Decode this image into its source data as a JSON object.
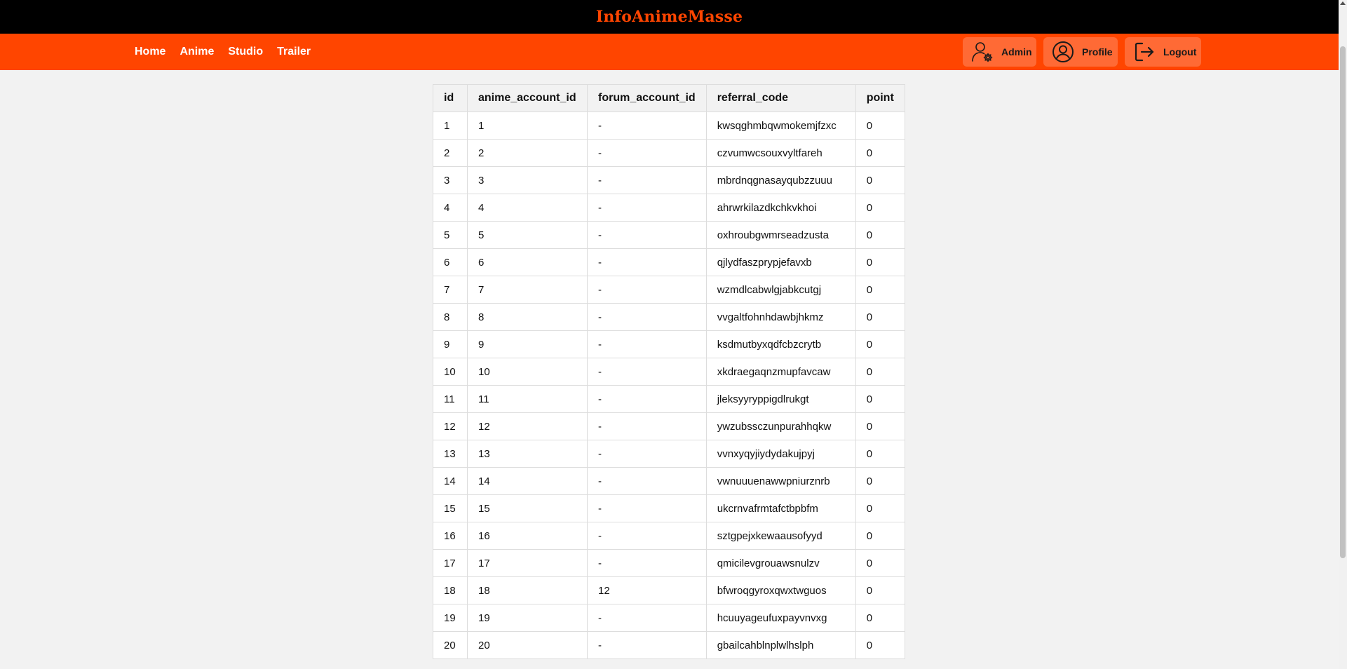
{
  "site": {
    "title": "InfoAnimeMasse"
  },
  "nav": {
    "links": [
      "Home",
      "Anime",
      "Studio",
      "Trailer"
    ],
    "actions": [
      {
        "label": "Admin",
        "icon": "admin-gear-icon"
      },
      {
        "label": "Profile",
        "icon": "user-circle-icon"
      },
      {
        "label": "Logout",
        "icon": "logout-icon"
      }
    ]
  },
  "colors": {
    "title_bar": "#000000",
    "nav_bar": "#ff4500",
    "accent": "#ff4500",
    "button_bg": "#ff6a35"
  },
  "table": {
    "columns": [
      "id",
      "anime_account_id",
      "forum_account_id",
      "referral_code",
      "point"
    ],
    "rows": [
      [
        "1",
        "1",
        "-",
        "kwsqghmbqwmokemjfzxc",
        "0"
      ],
      [
        "2",
        "2",
        "-",
        "czvumwcsouxvyltfareh",
        "0"
      ],
      [
        "3",
        "3",
        "-",
        "mbrdnqgnasayqubzzuuu",
        "0"
      ],
      [
        "4",
        "4",
        "-",
        "ahrwrkilazdkchkvkhoi",
        "0"
      ],
      [
        "5",
        "5",
        "-",
        "oxhroubgwmrseadzusta",
        "0"
      ],
      [
        "6",
        "6",
        "-",
        "qjlydfaszprypjefavxb",
        "0"
      ],
      [
        "7",
        "7",
        "-",
        "wzmdlcabwlgjabkcutgj",
        "0"
      ],
      [
        "8",
        "8",
        "-",
        "vvgaltfohnhdawbjhkmz",
        "0"
      ],
      [
        "9",
        "9",
        "-",
        "ksdmutbyxqdfcbzcrytb",
        "0"
      ],
      [
        "10",
        "10",
        "-",
        "xkdraegaqnzmupfavcaw",
        "0"
      ],
      [
        "11",
        "11",
        "-",
        "jleksyyryppigdlrukgt",
        "0"
      ],
      [
        "12",
        "12",
        "-",
        "ywzubssczunpurahhqkw",
        "0"
      ],
      [
        "13",
        "13",
        "-",
        "vvnxyqyjiydydakujpyj",
        "0"
      ],
      [
        "14",
        "14",
        "-",
        "vwnuuuenawwpniurznrb",
        "0"
      ],
      [
        "15",
        "15",
        "-",
        "ukcrnvafrmtafctbpbfm",
        "0"
      ],
      [
        "16",
        "16",
        "-",
        "sztgpejxkewaausofyyd",
        "0"
      ],
      [
        "17",
        "17",
        "-",
        "qmicilevgrouawsnulzv",
        "0"
      ],
      [
        "18",
        "18",
        "12",
        "bfwroqgyroxqwxtwguos",
        "0"
      ],
      [
        "19",
        "19",
        "-",
        "hcuuyageufuxpayvnvxg",
        "0"
      ],
      [
        "20",
        "20",
        "-",
        "gbailcahblnplwlhslph",
        "0"
      ]
    ]
  }
}
